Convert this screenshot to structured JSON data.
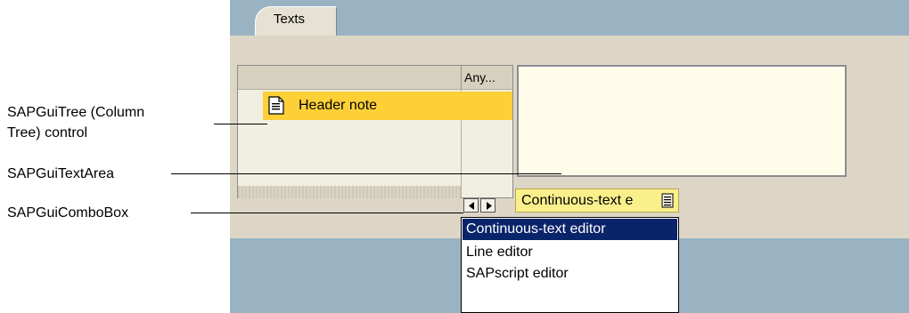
{
  "tab": {
    "label": "Texts"
  },
  "tree": {
    "column_header": "Any...",
    "rows": [
      {
        "label": "Header note"
      }
    ]
  },
  "combo": {
    "value": "Continuous-text e"
  },
  "dropdown": {
    "options": [
      "Continuous-text editor",
      "Line editor",
      "SAPscript editor"
    ],
    "selected_index": 0
  },
  "annotations": {
    "tree_line1": "SAPGuiTree (Column",
    "tree_line2": "Tree) control",
    "textarea": "SAPGuiTextArea",
    "combobox": "SAPGuiComboBox"
  },
  "colors": {
    "selection": "#0a246a",
    "highlight": "#fdd037",
    "combo_bg": "#f9f08c",
    "textarea_bg": "#fffde9"
  },
  "icons": [
    "document-icon",
    "scroll-left-icon",
    "scroll-right-icon",
    "dropdown-button-icon"
  ]
}
